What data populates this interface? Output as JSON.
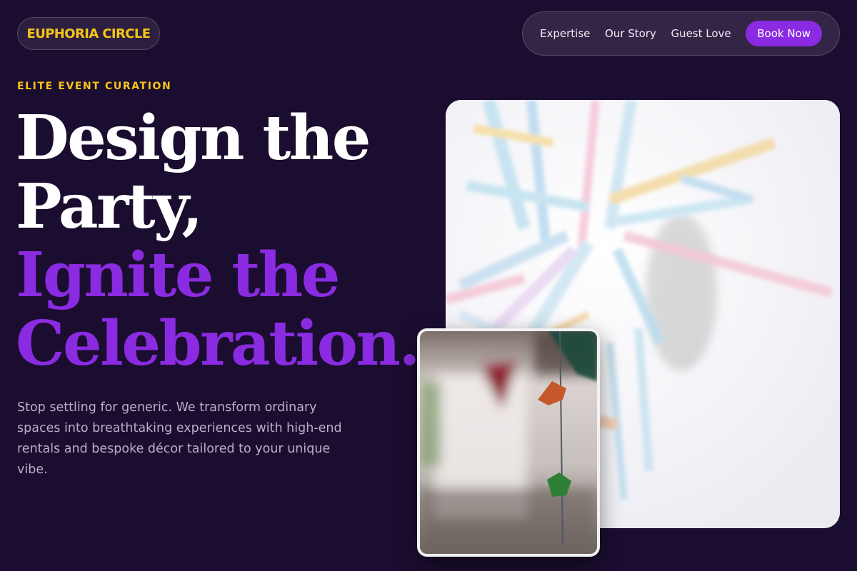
{
  "brand": {
    "logo": "EUPHORIA CIRCLE",
    "accent": "#f5c518",
    "primary": "#8a2be2",
    "background": "#1b0d30"
  },
  "nav": {
    "links": [
      "Expertise",
      "Our Story",
      "Guest Love"
    ],
    "cta": "Book Now"
  },
  "hero": {
    "eyebrow": "ELITE EVENT CURATION",
    "headline_white_1": "Design the",
    "headline_white_2": "Party,",
    "headline_purple_1": "Ignite the",
    "headline_purple_2": "Celebration.",
    "intro": "Stop settling for generic. We transform ordinary spaces into breathtaking experiences with high-end rentals and bespoke décor tailored to your unique vibe."
  },
  "images": {
    "main": "confetti-streamers-photo",
    "inset": "bunting-garland-photo"
  }
}
